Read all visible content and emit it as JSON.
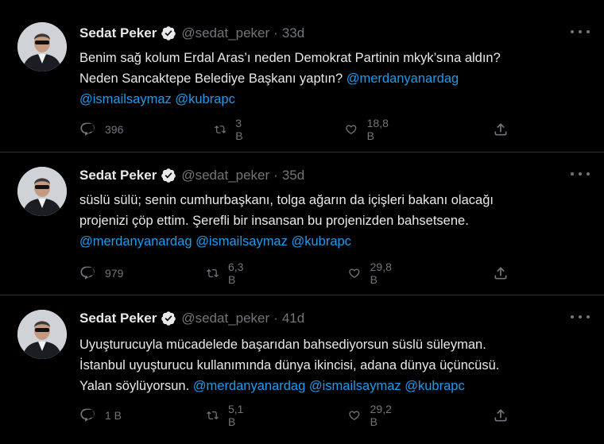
{
  "theme": {
    "background": "#000000",
    "text": "#e7e9ea",
    "muted": "#71767b",
    "accent": "#1d9bf0",
    "divider": "#2f3336"
  },
  "tweets": [
    {
      "author": {
        "name": "Sedat Peker",
        "handle": "@sedat_peker",
        "verified": true
      },
      "separator": "·",
      "time": "33d",
      "text_lines": [
        [
          {
            "t": "Benim sağ kolum Erdal Aras’ı neden Demokrat Partinin mkyk’sına aldın?",
            "m": false
          }
        ],
        [
          {
            "t": "Neden Sancaktepe Belediye Başkanı yaptın? ",
            "m": false
          },
          {
            "t": "@merdanyanardag",
            "m": true
          }
        ],
        [
          {
            "t": "@ismailsaymaz",
            "m": true
          },
          {
            "t": " ",
            "m": false
          },
          {
            "t": "@kubrapc",
            "m": true
          }
        ]
      ],
      "stats": {
        "replies": "396",
        "retweets": "3 B",
        "likes": "18,8 B"
      }
    },
    {
      "author": {
        "name": "Sedat Peker",
        "handle": "@sedat_peker",
        "verified": true
      },
      "separator": "·",
      "time": "35d",
      "text_lines": [
        [
          {
            "t": "süslü sülü; senin cumhurbaşkanı, tolga ağarın da içişleri bakanı olacağı",
            "m": false
          }
        ],
        [
          {
            "t": "projenizi çöp ettim. Şerefli bir insansan bu projenizden bahsetsene.",
            "m": false
          }
        ],
        [
          {
            "t": "@merdanyanardag",
            "m": true
          },
          {
            "t": " ",
            "m": false
          },
          {
            "t": "@ismailsaymaz",
            "m": true
          },
          {
            "t": " ",
            "m": false
          },
          {
            "t": "@kubrapc",
            "m": true
          }
        ]
      ],
      "stats": {
        "replies": "979",
        "retweets": "6,3 B",
        "likes": "29,8 B"
      }
    },
    {
      "author": {
        "name": "Sedat Peker",
        "handle": "@sedat_peker",
        "verified": true
      },
      "separator": "·",
      "time": "41d",
      "text_lines": [
        [
          {
            "t": "Uyuşturucuyla mücadelede başarıdan bahsediyorsun süslü süleyman.",
            "m": false
          }
        ],
        [
          {
            "t": "İstanbul uyuşturucu kullanımında dünya ikincisi, adana dünya üçüncüsü.",
            "m": false
          }
        ],
        [
          {
            "t": "Yalan söylüyorsun. ",
            "m": false
          },
          {
            "t": "@merdanyanardag",
            "m": true
          },
          {
            "t": " ",
            "m": false
          },
          {
            "t": "@ismailsaymaz",
            "m": true
          },
          {
            "t": " ",
            "m": false
          },
          {
            "t": "@kubrapc",
            "m": true
          }
        ]
      ],
      "stats": {
        "replies": "1 B",
        "retweets": "5,1 B",
        "likes": "29,2 B"
      }
    }
  ],
  "icons": {
    "reply": "reply-icon",
    "retweet": "retweet-icon",
    "like": "like-icon",
    "share": "share-icon",
    "more": "more-icon",
    "verified": "verified-badge-icon",
    "avatar": "avatar"
  }
}
